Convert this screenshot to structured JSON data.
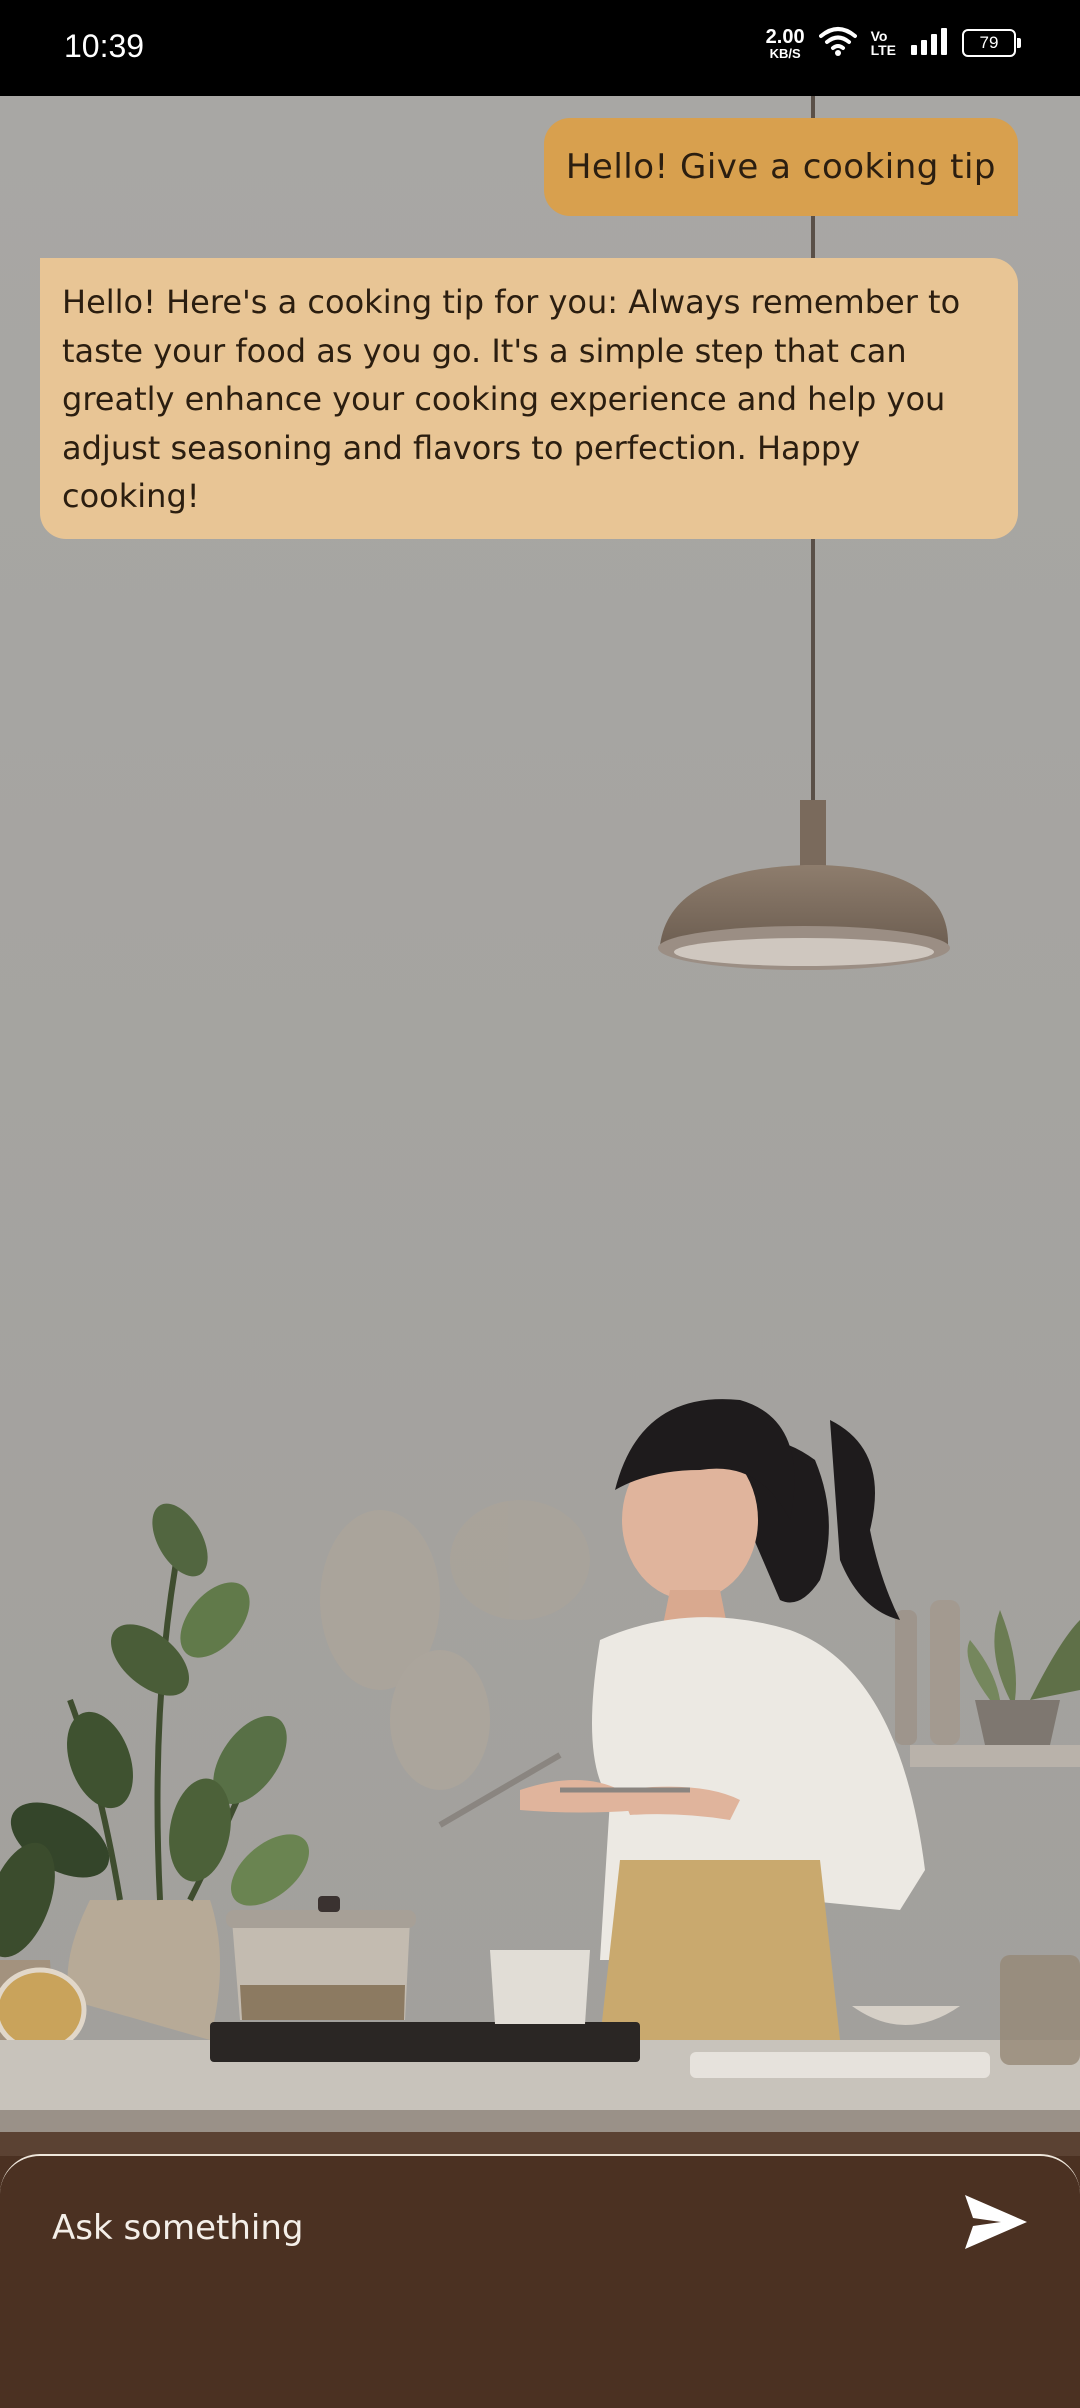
{
  "status_bar": {
    "time": "10:39",
    "net_speed_value": "2.00",
    "net_speed_unit": "KB/S",
    "volte_top": "Vo",
    "volte_bottom": "LTE",
    "battery": "79",
    "icons": [
      "wifi-icon",
      "volte-icon",
      "signal-icon",
      "battery-icon"
    ]
  },
  "chat": {
    "messages": [
      {
        "role": "user",
        "text": "Hello! Give a cooking tip"
      },
      {
        "role": "assistant",
        "text": "Hello! Here's a cooking tip for you: Always remember to taste your food as you go. It's a simple step that can greatly enhance your cooking experience and help you adjust seasoning and flavors to perfection. Happy cooking!"
      }
    ]
  },
  "composer": {
    "placeholder": "Ask something",
    "send_icon": "send-icon"
  },
  "colors": {
    "user_bubble": "#d8a04e",
    "assistant_bubble": "#e8c595",
    "input_bar": "#4b3122",
    "background": "#a7a6a3"
  }
}
